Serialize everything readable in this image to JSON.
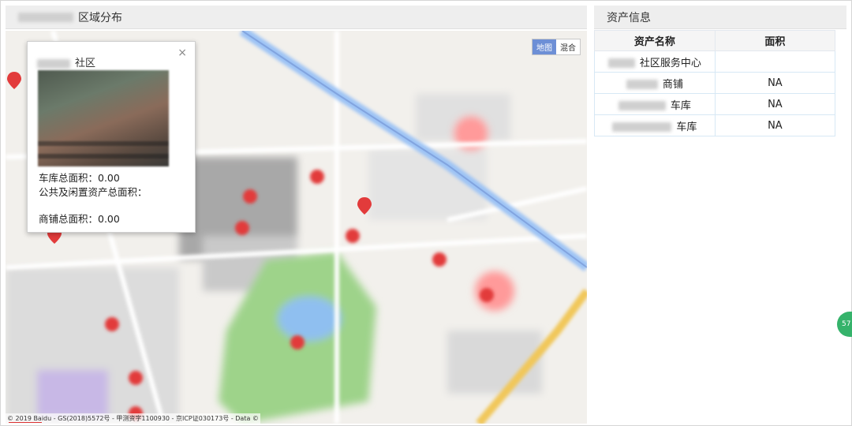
{
  "left_panel": {
    "title": "区域分布"
  },
  "map": {
    "switch": {
      "map": "地图",
      "hybrid": "混合"
    },
    "copyright": "© 2019 Baidu - GS(2018)5572号 - 甲测资字1100930 - 京ICP证030173号 - Data ©"
  },
  "popup": {
    "title": "社区",
    "close": "×",
    "garage_area": "车库总面积：0.00",
    "public_idle_area": "公共及闲置资产总面积：",
    "shop_area": "商铺总面积：0.00"
  },
  "right_panel": {
    "title": "资产信息",
    "columns": [
      "资产名称",
      "面积"
    ],
    "rows": [
      {
        "name": "社区服务中心",
        "area": ""
      },
      {
        "name": "商铺",
        "area": "NA"
      },
      {
        "name": "车库",
        "area": "NA"
      },
      {
        "name": "车库",
        "area": "NA"
      }
    ]
  },
  "side_badge": "57",
  "colors": {
    "marker": "#e23b3b",
    "river": "#9cc3f5",
    "park": "#bfe3b0",
    "header_bg": "#eeeeee",
    "switch_active": "#6d8fd6"
  }
}
